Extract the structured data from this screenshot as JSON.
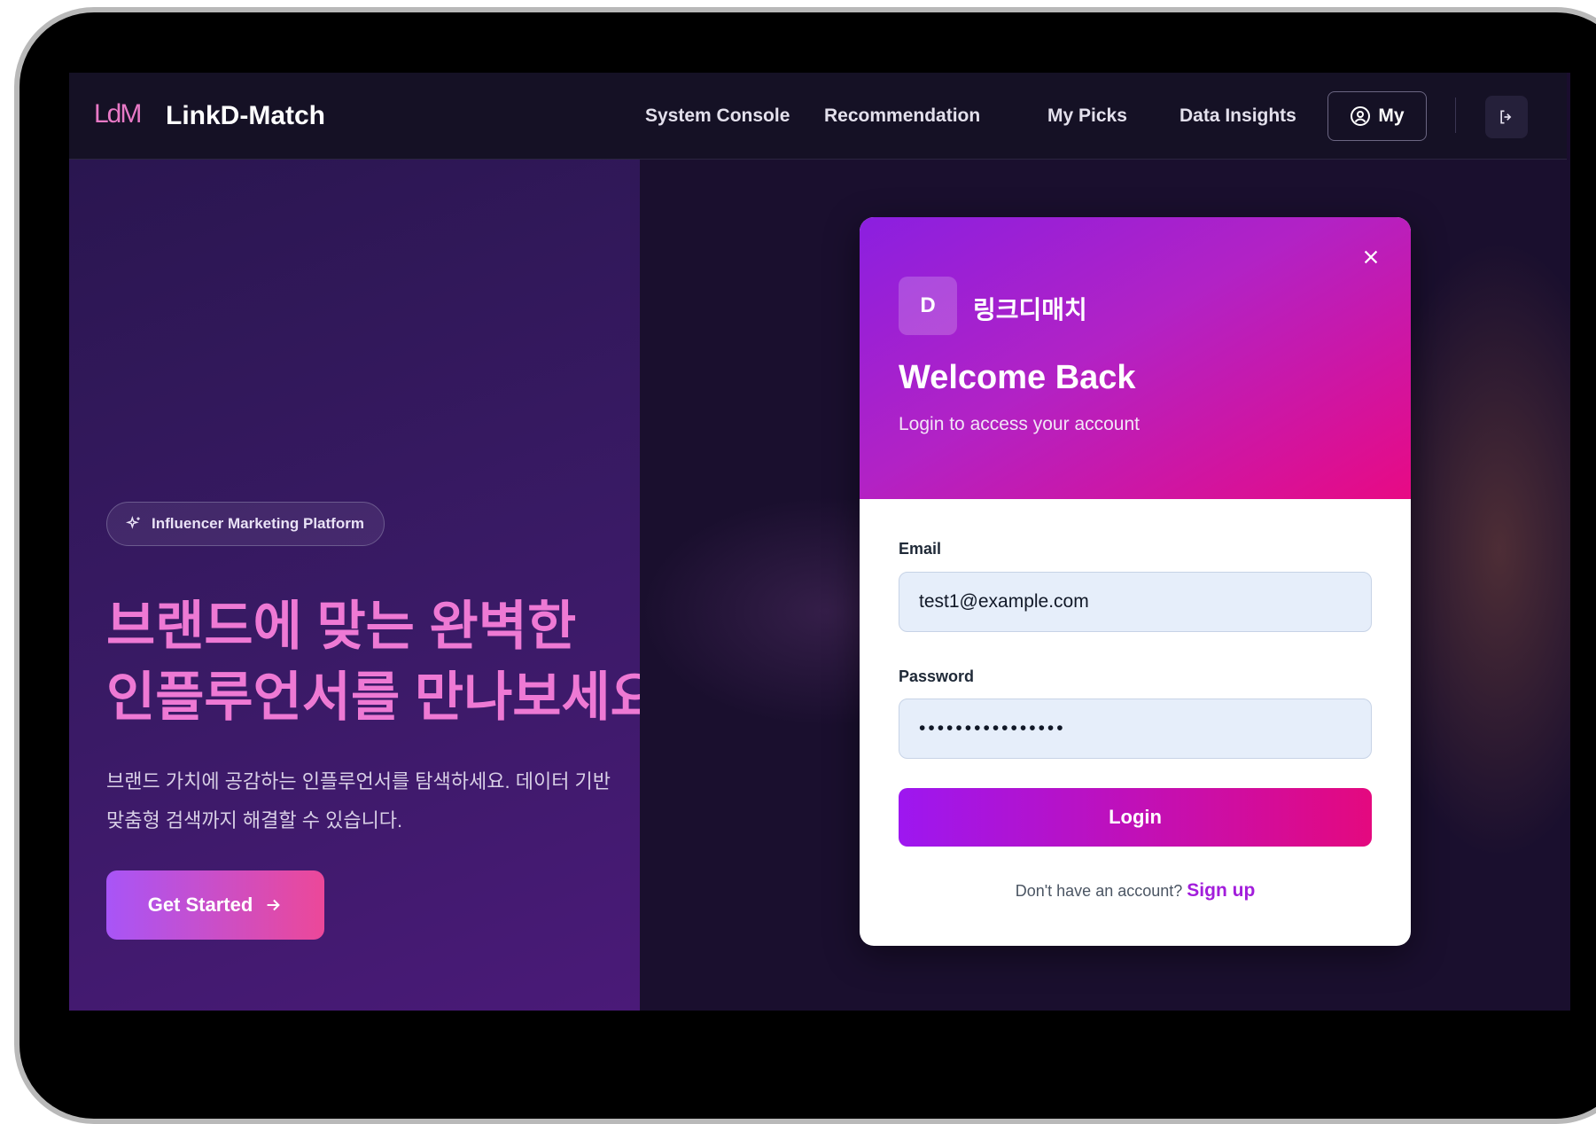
{
  "nav": {
    "logo_mark": "LdM",
    "app_name": "LinkD-Match",
    "links": [
      "System Console",
      "Recommendation",
      "My Picks",
      "Data Insights"
    ],
    "my_label": "My"
  },
  "hero": {
    "badge": "Influencer Marketing Platform",
    "headline_line1": "브랜드에 맞는 완벽한",
    "headline_line2": "인플루언서를 만나보세요",
    "subtext_line1": "브랜드 가치에 공감하는 인플루언서를 탐색하세요. 데이터 기반",
    "subtext_line2": "맞춤형 검색까지 해결할 수 있습니다.",
    "cta": "Get Started"
  },
  "modal": {
    "brand_initial": "D",
    "brand_name": "링크디매치",
    "title": "Welcome Back",
    "subtitle": "Login to access your account",
    "email_label": "Email",
    "email_value": "test1@example.com",
    "password_label": "Password",
    "password_value": "••••••••••••••••",
    "login_label": "Login",
    "signup_prompt": "Don't have an account?",
    "signup_link": "Sign up"
  },
  "colors": {
    "accent_start": "#9d17f0",
    "accent_end": "#e4097f",
    "headline": "#ee79d4"
  }
}
